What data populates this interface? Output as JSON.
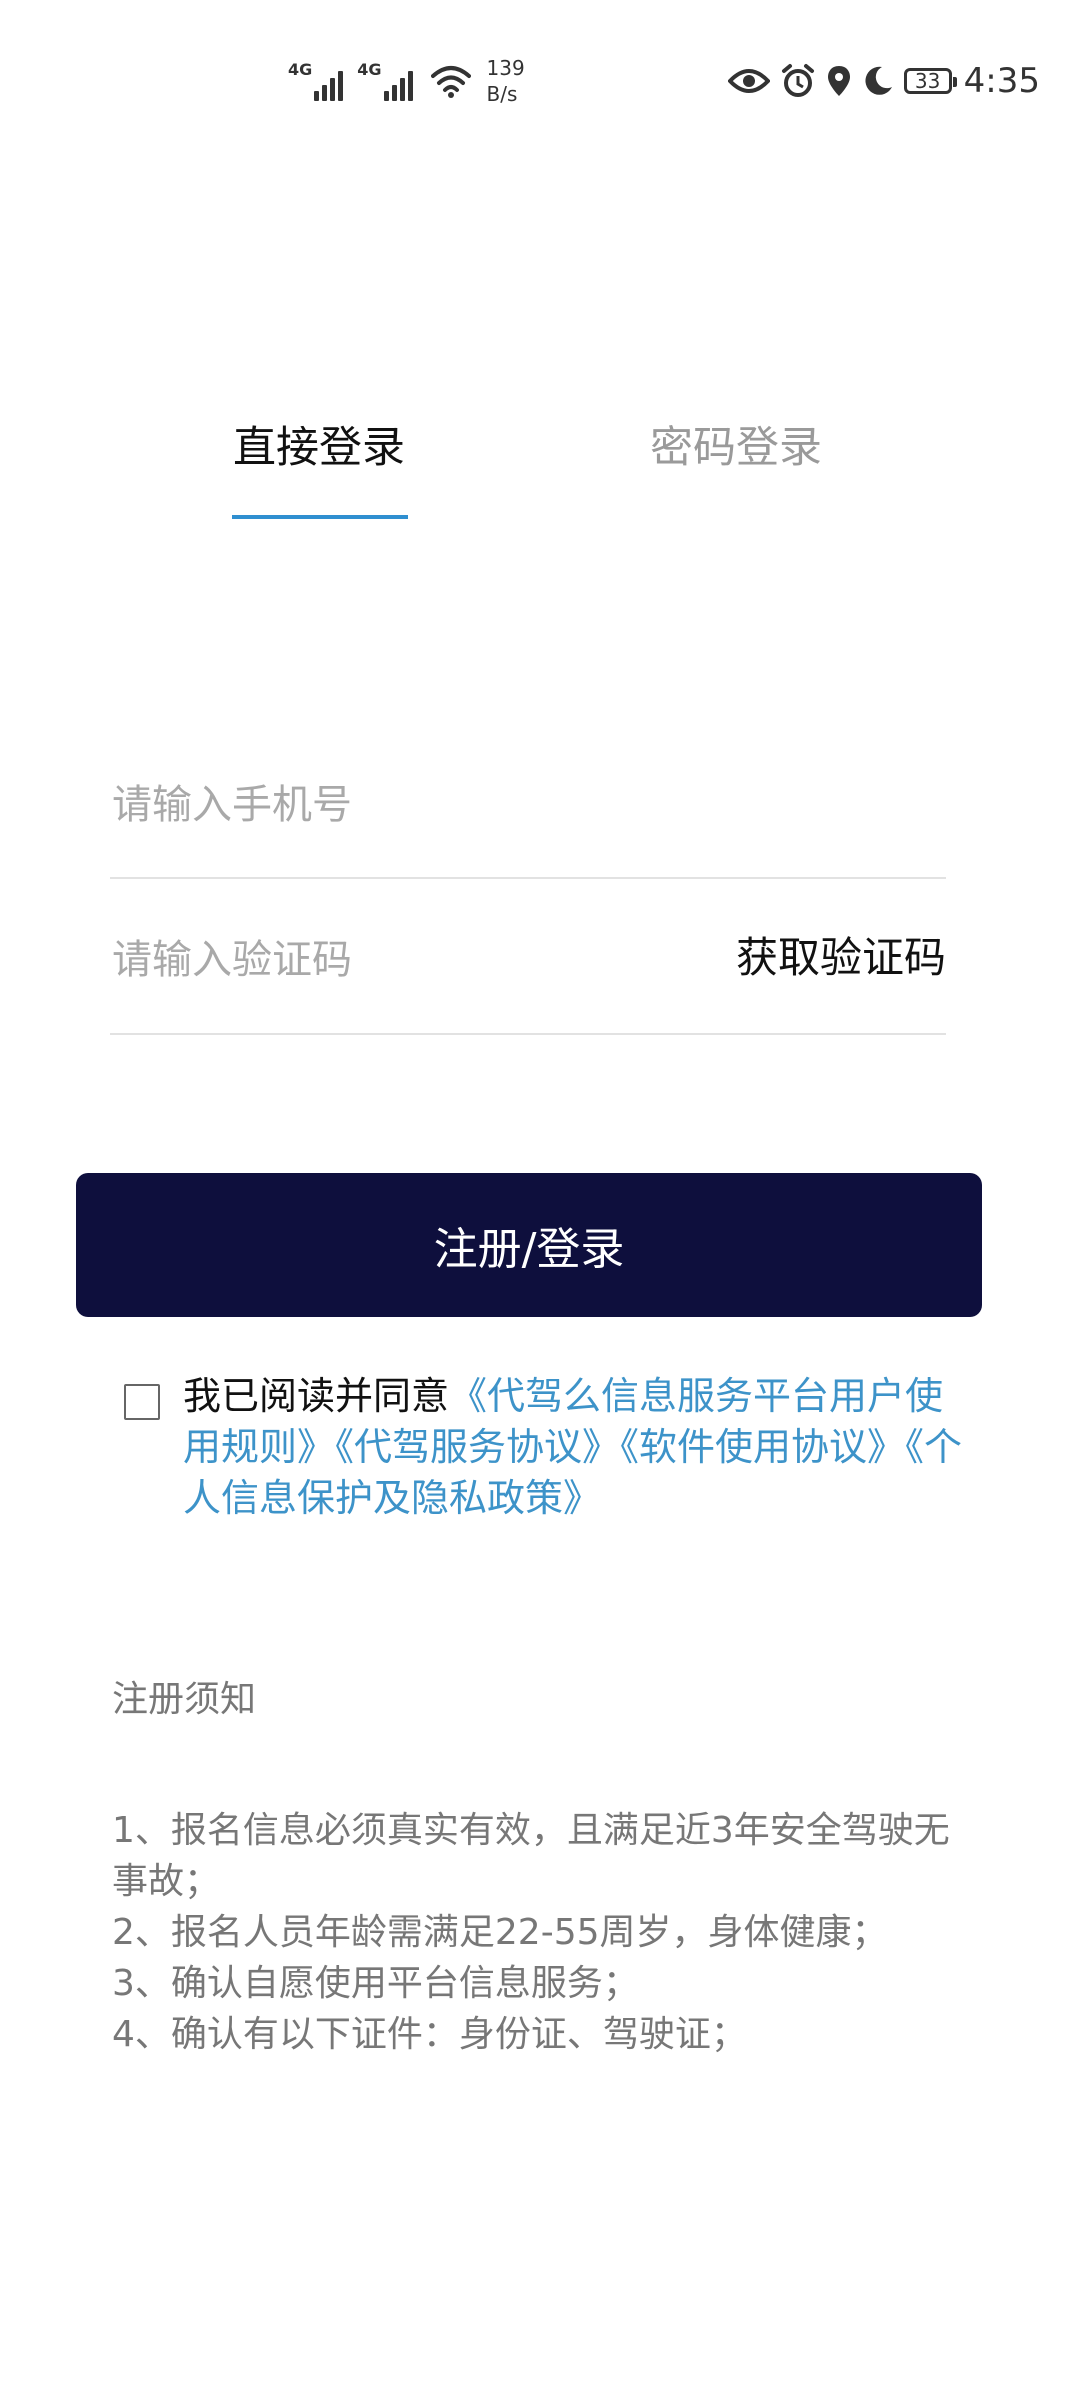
{
  "status_bar": {
    "net1_label": "4G",
    "net2_label": "4G",
    "speed_value": "139",
    "speed_unit": "B/s",
    "battery": "33",
    "time": "4:35",
    "icons": [
      "signal-icon",
      "wifi-icon",
      "eye-icon",
      "alarm-icon",
      "location-icon",
      "moon-icon",
      "battery-icon"
    ]
  },
  "tabs": {
    "direct_login": "直接登录",
    "password_login": "密码登录",
    "active": "direct_login"
  },
  "form": {
    "phone_placeholder": "请输入手机号",
    "code_placeholder": "请输入验证码",
    "get_code": "获取验证码",
    "submit": "注册/登录"
  },
  "agreement": {
    "checked": false,
    "prefix": "我已阅读并同意",
    "links": [
      "《代驾么信息服务平台用户使用规则》",
      "《代驾服务协议》",
      "《软件使用协议》",
      "《个人信息保护及隐私政策》"
    ]
  },
  "notice": {
    "title": "注册须知",
    "items": [
      "1、报名信息必须真实有效，且满足近3年安全驾驶无事故；",
      "2、报名人员年龄需满足22-55周岁，身体健康；",
      "3、确认自愿使用平台信息服务；",
      "4、确认有以下证件：身份证、驾驶证；"
    ]
  },
  "colors": {
    "tab_indicator": "#2f8fd0",
    "button_bg": "#0e0f3d",
    "link": "#3d93c9",
    "muted_text": "#777777",
    "placeholder": "#a9a9a9"
  }
}
